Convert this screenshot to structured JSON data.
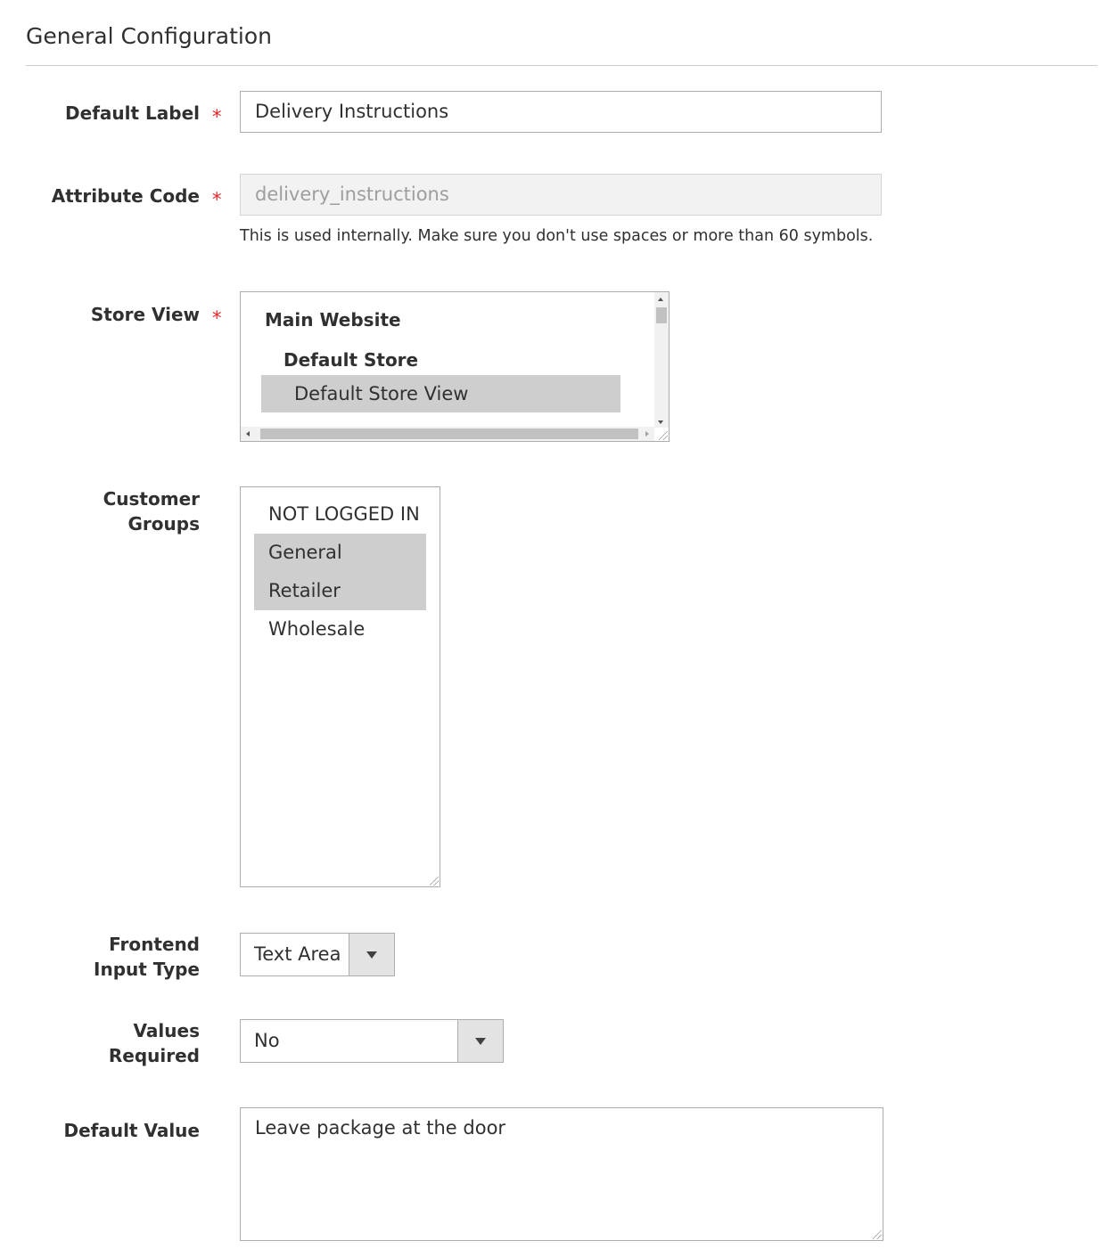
{
  "section": {
    "title": "General Configuration"
  },
  "fields": {
    "default_label": {
      "label": "Default Label",
      "required_mark": "*",
      "value": "Delivery Instructions"
    },
    "attribute_code": {
      "label": "Attribute Code",
      "required_mark": "*",
      "value": "delivery_instructions",
      "note": "This is used internally. Make sure you don't use spaces or more than 60 symbols."
    },
    "store_view": {
      "label": "Store View",
      "required_mark": "*",
      "website": "Main Website",
      "store": "Default Store",
      "selected_view": "Default Store View"
    },
    "customer_groups": {
      "label_line1": "Customer",
      "label_line2": "Groups",
      "options": [
        {
          "label": "NOT LOGGED IN",
          "selected": false
        },
        {
          "label": "General",
          "selected": true
        },
        {
          "label": "Retailer",
          "selected": true
        },
        {
          "label": "Wholesale",
          "selected": false
        }
      ]
    },
    "frontend_input_type": {
      "label_line1": "Frontend",
      "label_line2": "Input Type",
      "value": "Text Area"
    },
    "values_required": {
      "label_line1": "Values",
      "label_line2": "Required",
      "value": "No"
    },
    "default_value": {
      "label": "Default Value",
      "value": "Leave package at the door"
    }
  },
  "colors": {
    "required": "#e22626",
    "selected_option": "#cecece",
    "disabled_input": "#f2f2f2"
  },
  "icons": {
    "select_caret": "caret-down-icon",
    "resize": "resize-grip-icon"
  }
}
